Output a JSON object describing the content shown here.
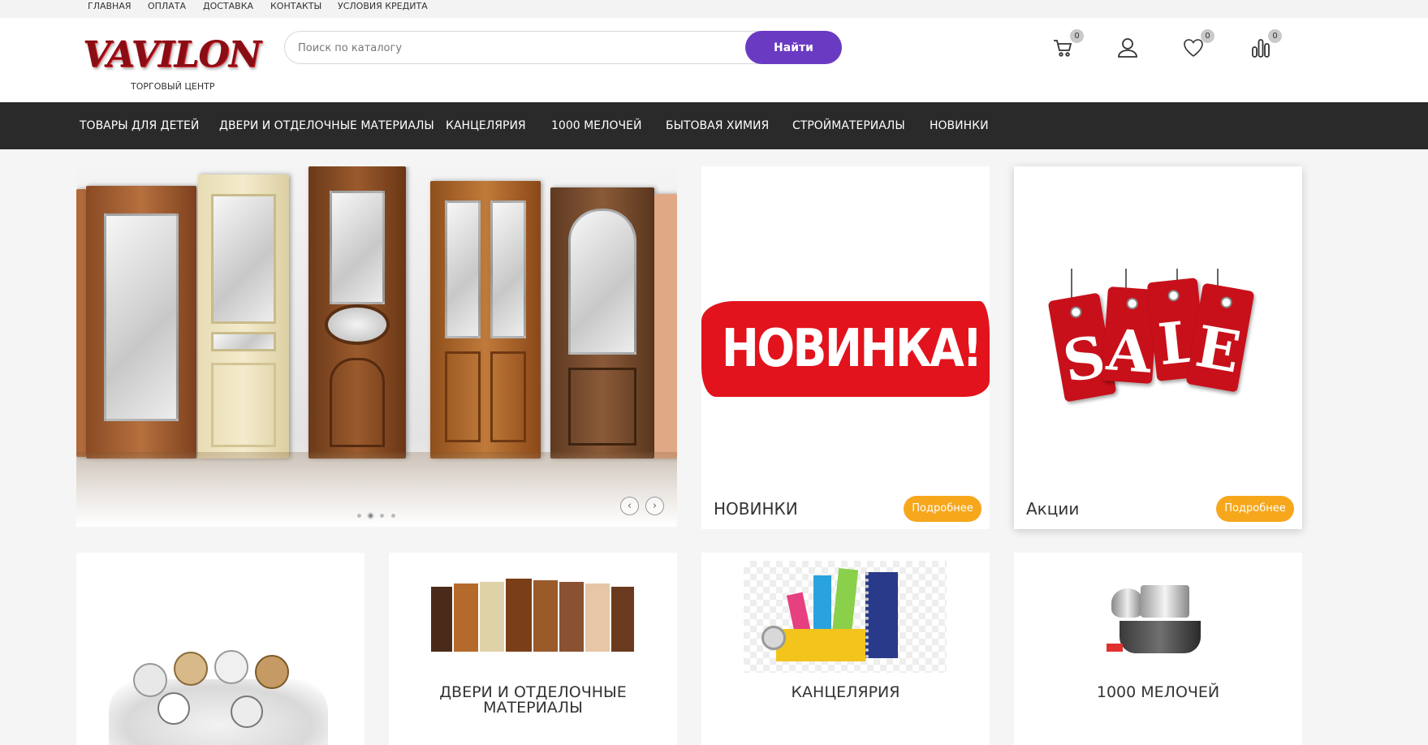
{
  "topbar": {
    "links": [
      "ГЛАВНАЯ",
      "ОПЛАТА",
      "ДОСТАВКА",
      "КОНТАКТЫ",
      "УСЛОВИЯ КРЕДИТА"
    ]
  },
  "header": {
    "logo_text": "VAVILON",
    "logo_subtitle": "ТОРГОВЫЙ ЦЕНТР",
    "search_placeholder": "Поиск по каталогу",
    "search_button": "Найти",
    "icons": [
      {
        "name": "cart-icon",
        "count": "0"
      },
      {
        "name": "user-icon"
      },
      {
        "name": "heart-icon",
        "count": "0"
      },
      {
        "name": "compare-icon",
        "count": "0"
      }
    ]
  },
  "nav": {
    "items": [
      "ТОВАРЫ ДЛЯ ДЕТЕЙ",
      "ДВЕРИ И ОТДЕЛОЧНЫЕ МАТЕРИАЛЫ",
      "КАНЦЕЛЯРИЯ",
      "1000 МЕЛОЧЕЙ",
      "БЫТОВАЯ ХИМИЯ",
      "СТРОЙМАТЕРИАЛЫ",
      "НОВИНКИ"
    ]
  },
  "slider": {
    "dots": 4,
    "active_dot": 1
  },
  "promos": [
    {
      "title": "НОВИНКИ",
      "image_text": "НОВИНКА!",
      "button": "Подробнее"
    },
    {
      "title": "Акции",
      "image_text": "SALE",
      "button": "Подробнее"
    }
  ],
  "categories": [
    {
      "label": ""
    },
    {
      "label": "ДВЕРИ И ОТДЕЛОЧНЫЕ МАТЕРИАЛЫ"
    },
    {
      "label": "КАНЦЕЛЯРИЯ"
    },
    {
      "label": "1000 МЕЛОЧЕЙ"
    }
  ],
  "colors": {
    "brand_red": "#8b0d14",
    "search_button": "#6a3bc2",
    "nav_background": "#2a2a2a",
    "more_button": "#f6a71c"
  }
}
